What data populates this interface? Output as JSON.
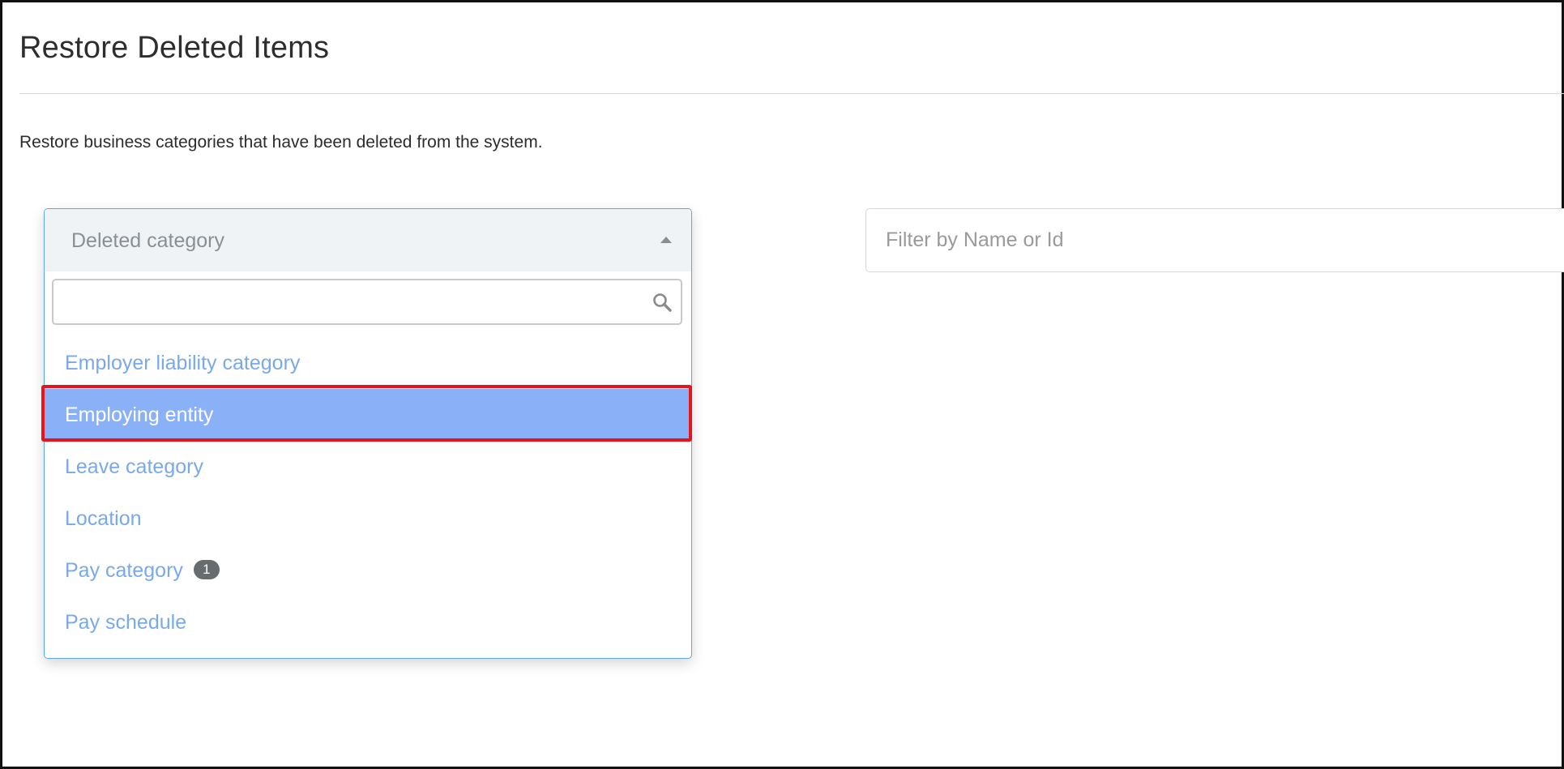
{
  "page": {
    "title": "Restore Deleted Items",
    "description": "Restore business categories that have been deleted from the system."
  },
  "category_select": {
    "placeholder": "Deleted category",
    "search_value": "",
    "options": [
      {
        "label": "Employer liability category",
        "badge": null,
        "active": false
      },
      {
        "label": "Employing entity",
        "badge": null,
        "active": true
      },
      {
        "label": "Leave category",
        "badge": null,
        "active": false
      },
      {
        "label": "Location",
        "badge": null,
        "active": false
      },
      {
        "label": "Pay category",
        "badge": "1",
        "active": false
      },
      {
        "label": "Pay schedule",
        "badge": null,
        "active": false
      }
    ]
  },
  "filter": {
    "placeholder": "Filter by Name or Id",
    "value": ""
  },
  "icons": {
    "dropdown_caret": "caret-up-icon",
    "search": "search-icon"
  },
  "colors": {
    "select_border": "#5aa9e6",
    "option_text": "#7aa9ea",
    "option_active_bg": "#8ab1f8",
    "highlight": "#e8141c",
    "badge_bg": "#666c70"
  }
}
